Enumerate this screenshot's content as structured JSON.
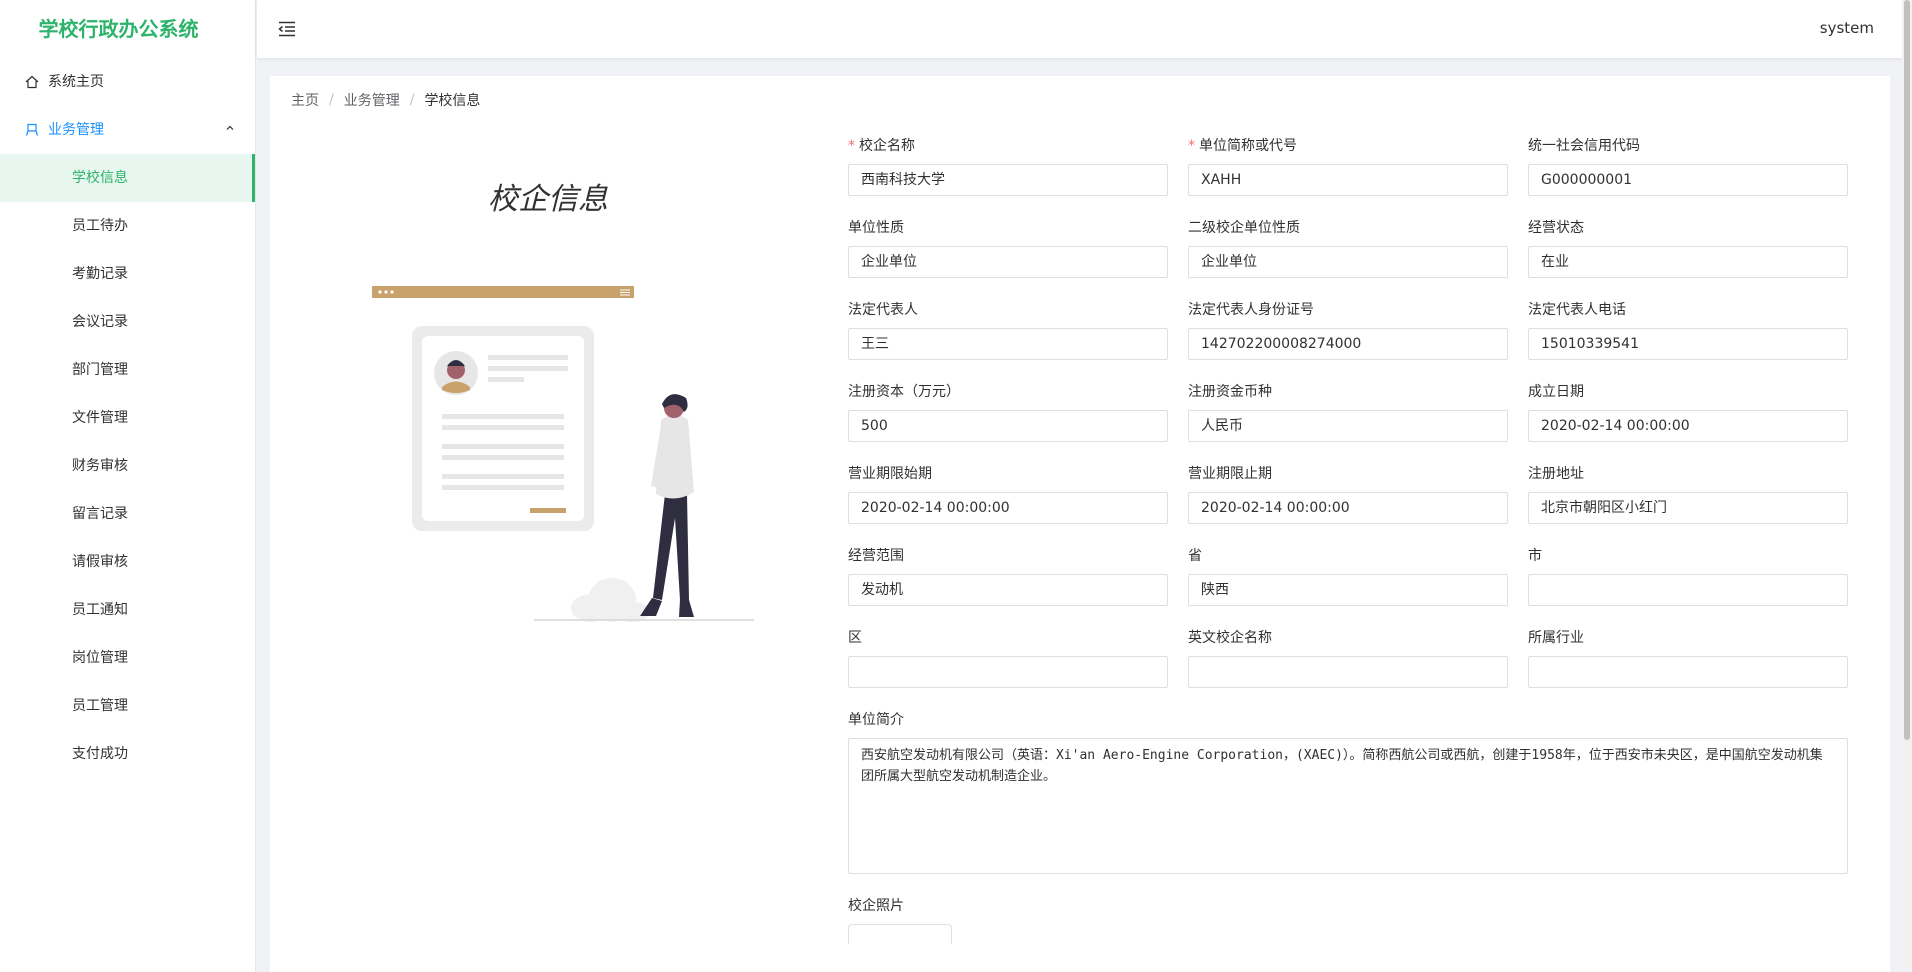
{
  "app": {
    "title": "学校行政办公系统",
    "user": "system"
  },
  "sidebar": {
    "home": "系统主页",
    "group": "业务管理",
    "items": [
      "学校信息",
      "员工待办",
      "考勤记录",
      "会议记录",
      "部门管理",
      "文件管理",
      "财务审核",
      "留言记录",
      "请假审核",
      "员工通知",
      "岗位管理",
      "员工管理",
      "支付成功"
    ]
  },
  "breadcrumb": {
    "home": "主页",
    "section": "业务管理",
    "current": "学校信息",
    "sep": "/"
  },
  "page": {
    "title": "校企信息"
  },
  "form": {
    "fields": [
      {
        "label": "校企名称",
        "value": "西南科技大学",
        "required": true
      },
      {
        "label": "单位简称或代号",
        "value": "XAHH",
        "required": true
      },
      {
        "label": "统一社会信用代码",
        "value": "G000000001"
      },
      {
        "label": "单位性质",
        "value": "企业单位"
      },
      {
        "label": "二级校企单位性质",
        "value": "企业单位"
      },
      {
        "label": "经营状态",
        "value": "在业"
      },
      {
        "label": "法定代表人",
        "value": "王三"
      },
      {
        "label": "法定代表人身份证号",
        "value": "142702200008274000"
      },
      {
        "label": "法定代表人电话",
        "value": "15010339541"
      },
      {
        "label": "注册资本（万元）",
        "value": "500"
      },
      {
        "label": "注册资金币种",
        "value": "人民币"
      },
      {
        "label": "成立日期",
        "value": "2020-02-14 00:00:00"
      },
      {
        "label": "营业期限始期",
        "value": "2020-02-14 00:00:00"
      },
      {
        "label": "营业期限止期",
        "value": "2020-02-14 00:00:00"
      },
      {
        "label": "注册地址",
        "value": "北京市朝阳区小红门"
      },
      {
        "label": "经营范围",
        "value": "发动机"
      },
      {
        "label": "省",
        "value": "陕西"
      },
      {
        "label": "市",
        "value": ""
      },
      {
        "label": "区",
        "value": ""
      },
      {
        "label": "英文校企名称",
        "value": ""
      },
      {
        "label": "所属行业",
        "value": ""
      }
    ],
    "intro_label": "单位简介",
    "intro_value": "西安航空发动机有限公司（英语：Xi'an Aero-Engine Corporation，(XAEC)）。简称西航公司或西航，创建于1958年，位于西安市未央区，是中国航空发动机集团所属大型航空发动机制造企业。",
    "photo_label": "校企照片"
  },
  "colors": {
    "brand": "#2db36b",
    "active_bg": "#e7f6ee",
    "link": "#1890ff",
    "required": "#f56c6c",
    "illustration_accent": "#c9a26b"
  }
}
